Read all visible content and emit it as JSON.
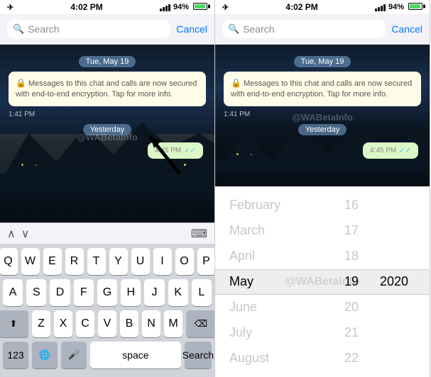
{
  "status": {
    "time": "4:02 PM",
    "signal": "94%",
    "airplane": "✈"
  },
  "search": {
    "placeholder": "Search",
    "cancel_label": "Cancel"
  },
  "chat": {
    "date_badge": "Tue, May 19",
    "yesterday_badge": "Yesterday",
    "encryption_message": "Messages to this chat and calls are now secured with end-to-end encryption. Tap for more info.",
    "lock_icon": "🔒",
    "time_sent": "1:41 PM",
    "bubble_time": "4:45 PM",
    "checkmarks": "✓✓",
    "watermark": "@WABetaInfo"
  },
  "keyboard": {
    "rows": [
      [
        "Q",
        "W",
        "E",
        "R",
        "T",
        "Y",
        "U",
        "I",
        "O",
        "P"
      ],
      [
        "A",
        "S",
        "D",
        "F",
        "G",
        "H",
        "J",
        "K",
        "L"
      ],
      [
        "Z",
        "X",
        "C",
        "V",
        "B",
        "N",
        "M"
      ]
    ],
    "shift_icon": "⬆",
    "delete_icon": "⌫",
    "num_label": "123",
    "globe_icon": "🌐",
    "mic_icon": "🎤",
    "space_label": "space",
    "search_label": "Search"
  },
  "nav": {
    "up_arrow": "∧",
    "down_arrow": "∨",
    "keyboard_icon": "⌨"
  },
  "date_picker": {
    "months": [
      "February",
      "March",
      "April",
      "May",
      "June",
      "July",
      "August"
    ],
    "days": [
      16,
      17,
      18,
      19,
      20,
      21,
      22
    ],
    "selected_month": "May",
    "selected_day": 19,
    "selected_year": 2020,
    "watermark": "@WABetaInfo"
  }
}
